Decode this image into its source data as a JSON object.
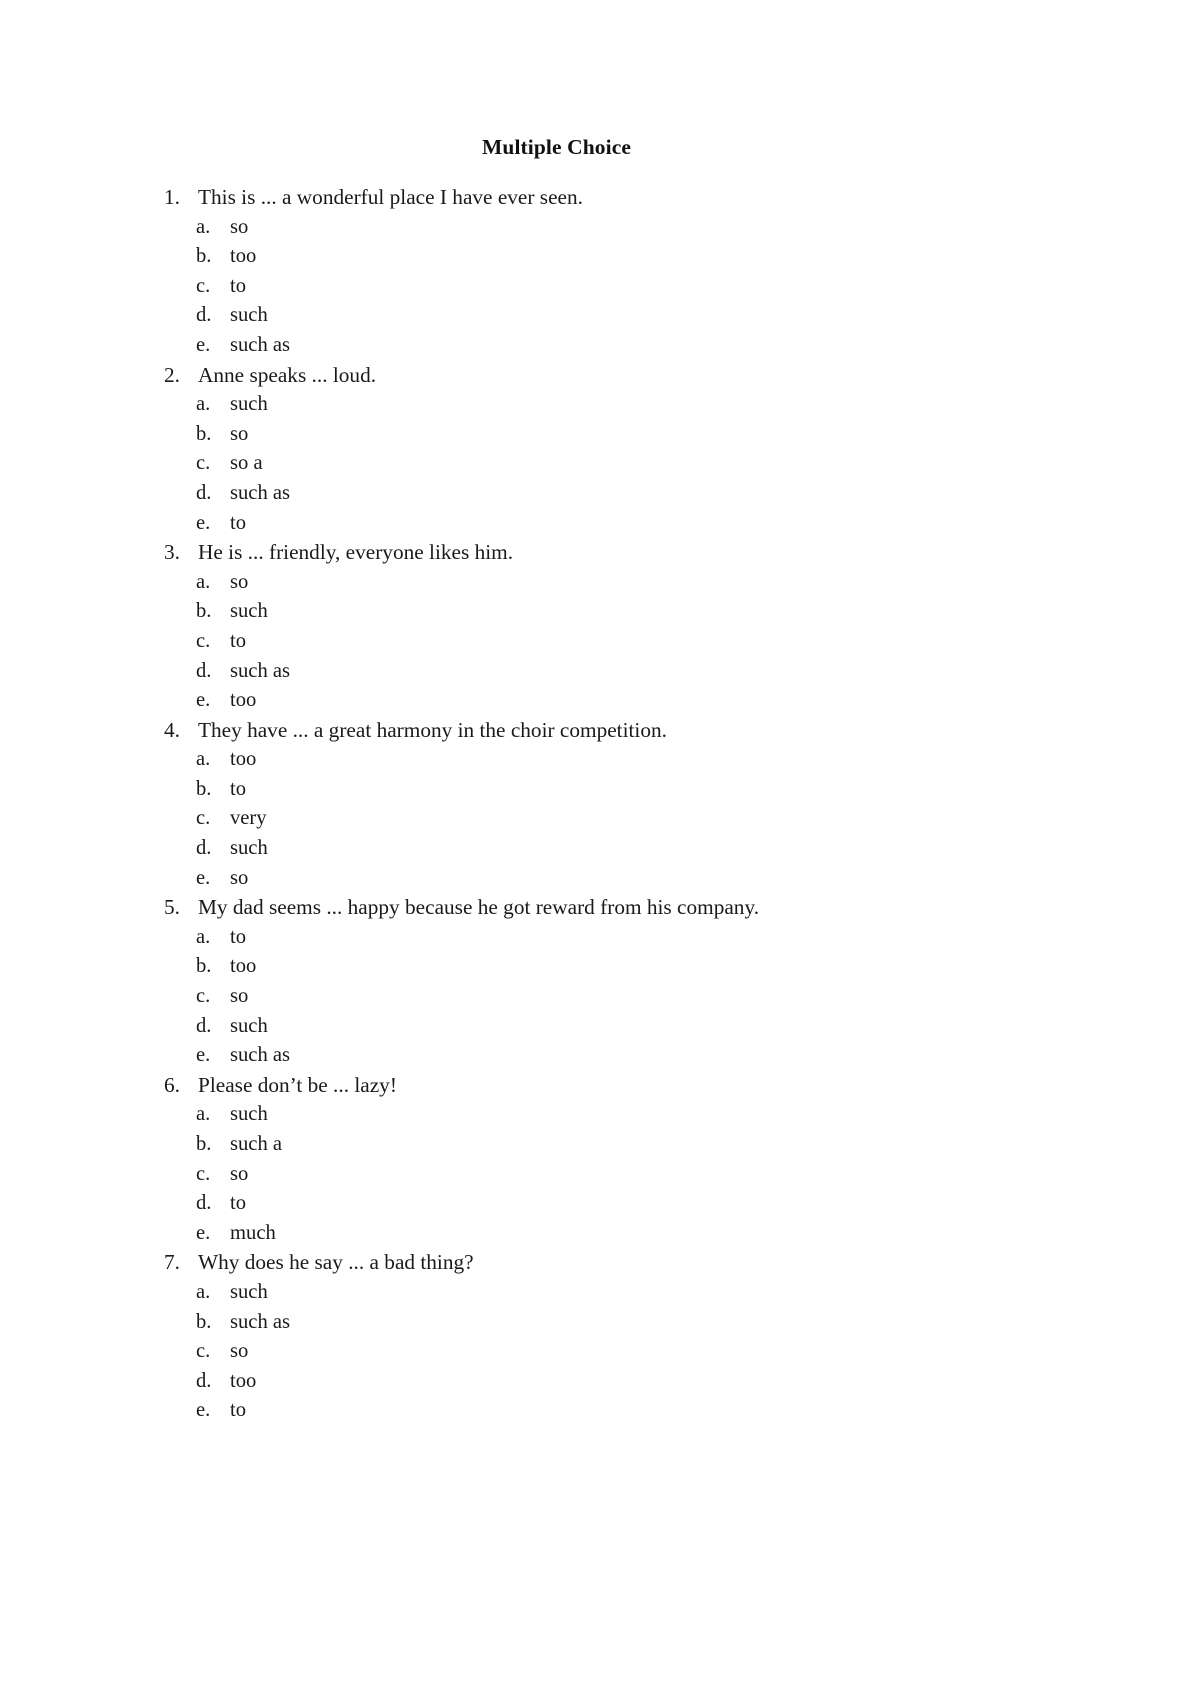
{
  "document": {
    "title": "Multiple Choice",
    "page_background": "#ffffff",
    "text_color": "#1a1a1a"
  },
  "questions": [
    {
      "number": "1.",
      "text": "This is ... a wonderful place I have ever seen.",
      "options": [
        {
          "letter": "a.",
          "text": "so"
        },
        {
          "letter": "b.",
          "text": "too"
        },
        {
          "letter": "c.",
          "text": "to"
        },
        {
          "letter": "d.",
          "text": "such"
        },
        {
          "letter": "e.",
          "text": "such as"
        }
      ]
    },
    {
      "number": "2.",
      "text": "Anne speaks ... loud.",
      "options": [
        {
          "letter": "a.",
          "text": "such"
        },
        {
          "letter": "b.",
          "text": "so"
        },
        {
          "letter": "c.",
          "text": "so a"
        },
        {
          "letter": "d.",
          "text": "such as"
        },
        {
          "letter": "e.",
          "text": "to"
        }
      ]
    },
    {
      "number": "3.",
      "text": "He is ... friendly, everyone likes him.",
      "options": [
        {
          "letter": "a.",
          "text": "so"
        },
        {
          "letter": "b.",
          "text": "such"
        },
        {
          "letter": "c.",
          "text": "to"
        },
        {
          "letter": "d.",
          "text": "such as"
        },
        {
          "letter": "e.",
          "text": "too"
        }
      ]
    },
    {
      "number": "4.",
      "text": "They have ... a great harmony in the choir competition.",
      "options": [
        {
          "letter": "a.",
          "text": "too"
        },
        {
          "letter": "b.",
          "text": "to"
        },
        {
          "letter": "c.",
          "text": "very"
        },
        {
          "letter": "d.",
          "text": "such"
        },
        {
          "letter": "e.",
          "text": "so"
        }
      ]
    },
    {
      "number": "5.",
      "text": "My dad seems ... happy because he got reward from his company.",
      "options": [
        {
          "letter": "a.",
          "text": "to"
        },
        {
          "letter": "b.",
          "text": "too"
        },
        {
          "letter": "c.",
          "text": "so"
        },
        {
          "letter": "d.",
          "text": "such"
        },
        {
          "letter": "e.",
          "text": "such as"
        }
      ]
    },
    {
      "number": "6.",
      "text": "Please don’t be ... lazy!",
      "options": [
        {
          "letter": "a.",
          "text": "such"
        },
        {
          "letter": "b.",
          "text": "such a"
        },
        {
          "letter": "c.",
          "text": "so"
        },
        {
          "letter": "d.",
          "text": "to"
        },
        {
          "letter": "e.",
          "text": "much"
        }
      ]
    },
    {
      "number": "7.",
      "text": "Why does he say ... a bad thing?",
      "options": [
        {
          "letter": "a.",
          "text": "such"
        },
        {
          "letter": "b.",
          "text": "such as"
        },
        {
          "letter": "c.",
          "text": "so"
        },
        {
          "letter": "d.",
          "text": "too"
        },
        {
          "letter": "e.",
          "text": "to"
        }
      ]
    }
  ]
}
